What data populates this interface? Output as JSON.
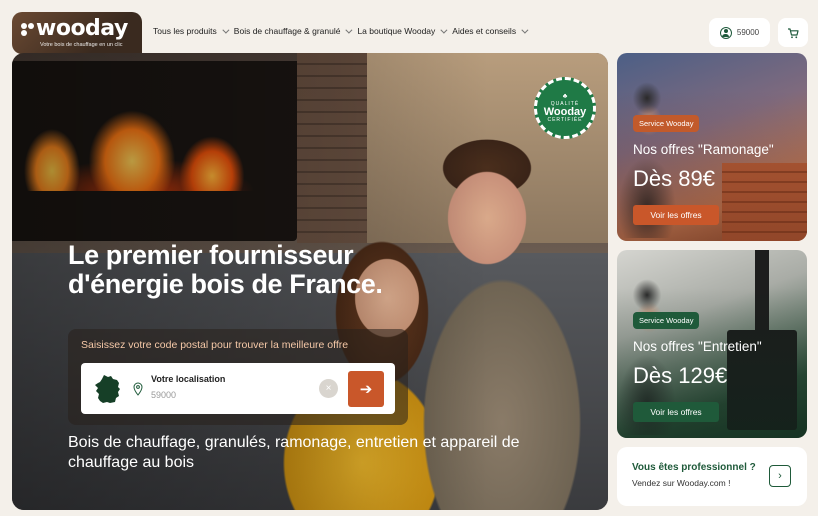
{
  "brand": {
    "name": "wooday",
    "tagline": "Votre bois de chauffage en un clic"
  },
  "nav": {
    "items": [
      {
        "label": "Tous les produits"
      },
      {
        "label": "Bois de chauffage & granulé"
      },
      {
        "label": "La boutique Wooday"
      },
      {
        "label": "Aides et conseils"
      }
    ]
  },
  "header": {
    "account_label": "59000"
  },
  "hero": {
    "title": "Le premier fournisseur d'énergie bois de France.",
    "badge": {
      "top": "QUALITÉ",
      "middle": "Wooday",
      "bottom": "CERTIFIÉE"
    },
    "search_hint": "Saisissez votre code postal pour trouver la meilleure offre",
    "location_label": "Votre localisation",
    "location_value": "59000",
    "clear_symbol": "×",
    "go_symbol": "➔",
    "subtitle": "Bois de chauffage, granulés, ramonage, entretien et appareil de chauffage au bois"
  },
  "cards": [
    {
      "tag": "Service Wooday",
      "title": "Nos offres \"Ramonage\"",
      "price": "Dès 89€",
      "button": "Voir les offres"
    },
    {
      "tag": "Service Wooday",
      "title": "Nos offres \"Entretien\"",
      "price": "Dès 129€",
      "button": "Voir les offres"
    }
  ],
  "pro": {
    "title": "Vous êtes professionnel ?",
    "subtitle": "Vendez sur Wooday.com !",
    "arrow": "›"
  },
  "colors": {
    "accent_orange": "#c9572a",
    "brand_green": "#1f5a3a",
    "background": "#f4f0ea"
  },
  "icons": [
    "user-icon",
    "cart-icon",
    "location-pin-icon",
    "france-map-icon",
    "arrow-right-icon",
    "chevron-down-icon",
    "chevron-right-icon"
  ]
}
